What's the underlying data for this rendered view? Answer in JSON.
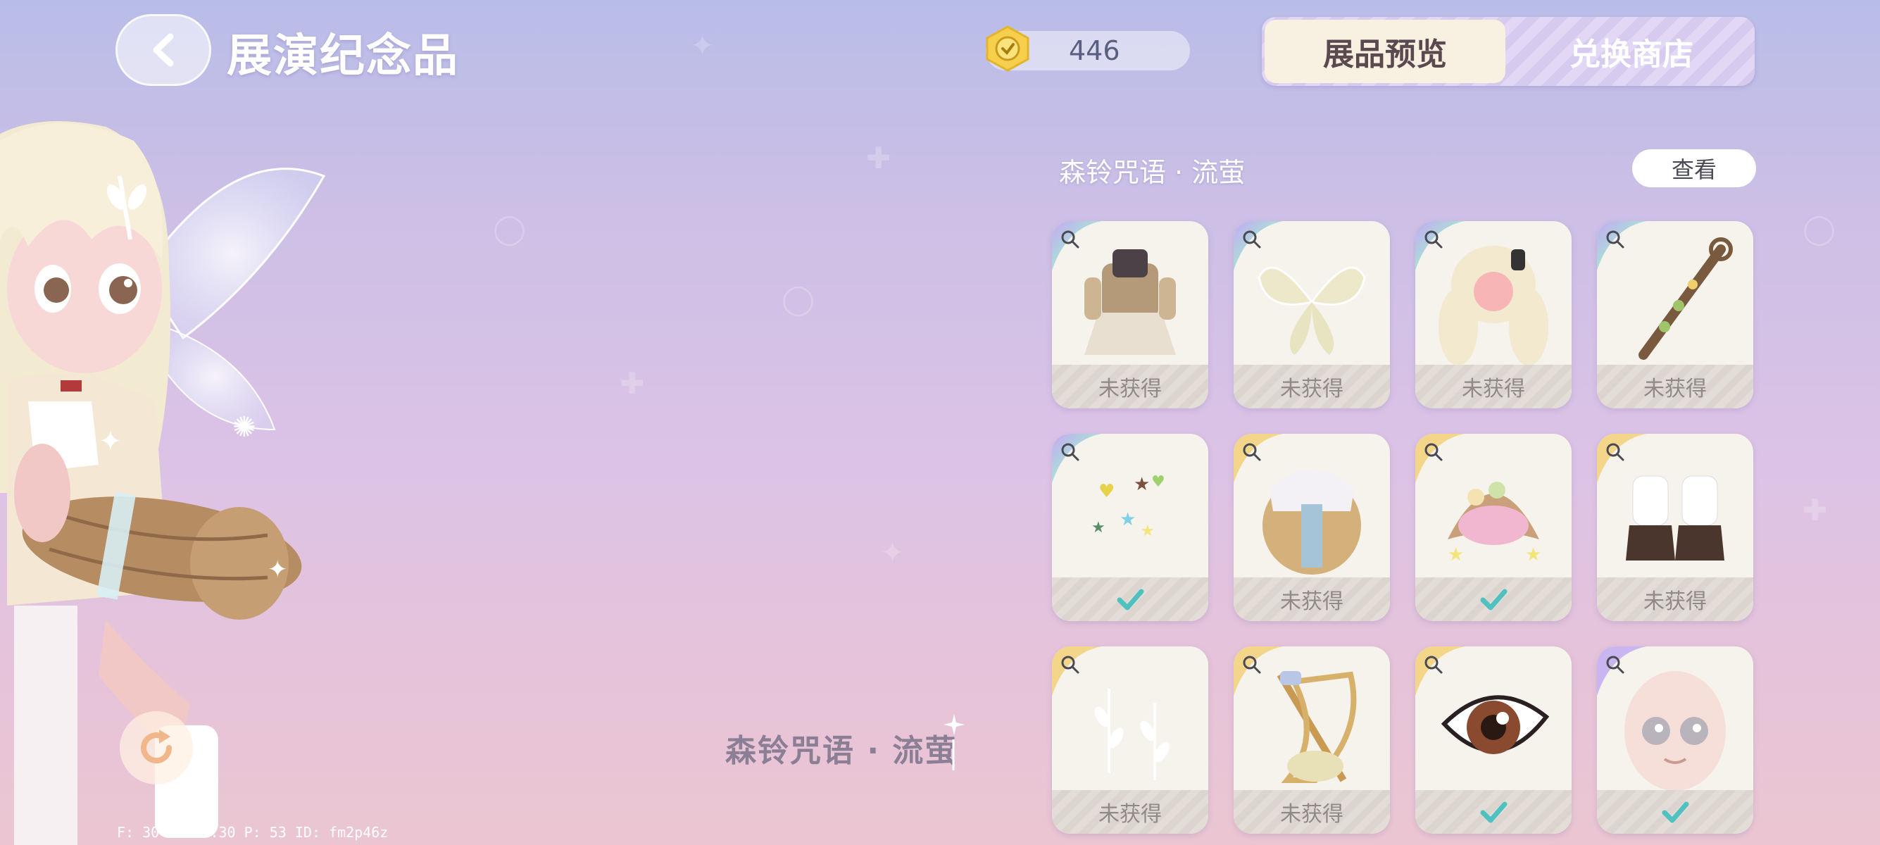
{
  "header": {
    "title": "展演纪念品",
    "currency_value": "446"
  },
  "tabs": [
    {
      "label": "展品预览",
      "active": true
    },
    {
      "label": "兑换商店",
      "active": false
    }
  ],
  "set": {
    "title": "森铃咒语 · 流萤",
    "view_label": "查看"
  },
  "items": [
    {
      "icon": "outfit-dress",
      "tier": "rainbow",
      "status": "未获得",
      "owned": false
    },
    {
      "icon": "fairy-wings",
      "tier": "rainbow",
      "status": "未获得",
      "owned": false
    },
    {
      "icon": "twin-tail-hair",
      "tier": "rainbow",
      "status": "未获得",
      "owned": false
    },
    {
      "icon": "vine-staff",
      "tier": "rainbow",
      "status": "未获得",
      "owned": false
    },
    {
      "icon": "star-sparkles",
      "tier": "rainbow",
      "status": "",
      "owned": true
    },
    {
      "icon": "long-hair-bonnet",
      "tier": "gold",
      "status": "未获得",
      "owned": false
    },
    {
      "icon": "flower-hat",
      "tier": "gold",
      "status": "",
      "owned": true
    },
    {
      "icon": "ribbon-shoes",
      "tier": "gold",
      "status": "未获得",
      "owned": false
    },
    {
      "icon": "leaf-tattoo",
      "tier": "gold",
      "status": "未获得",
      "owned": false
    },
    {
      "icon": "harp-instrument",
      "tier": "gold",
      "status": "未获得",
      "owned": false
    },
    {
      "icon": "brown-eye",
      "tier": "gold",
      "status": "",
      "owned": true
    },
    {
      "icon": "face-makeup",
      "tier": "purple",
      "status": "",
      "owned": true
    }
  ],
  "character": {
    "outfit_name": "森铃咒语 · 流萤",
    "stats": "F: 30    T: 54.30    P: 53    ID: fm2p46z"
  },
  "colors": {
    "check": "#4fc1c0",
    "tab_active_bg": "#f8f0e0",
    "tier_gold": "#f3d68a",
    "tier_purple": "#c9b6f0"
  }
}
